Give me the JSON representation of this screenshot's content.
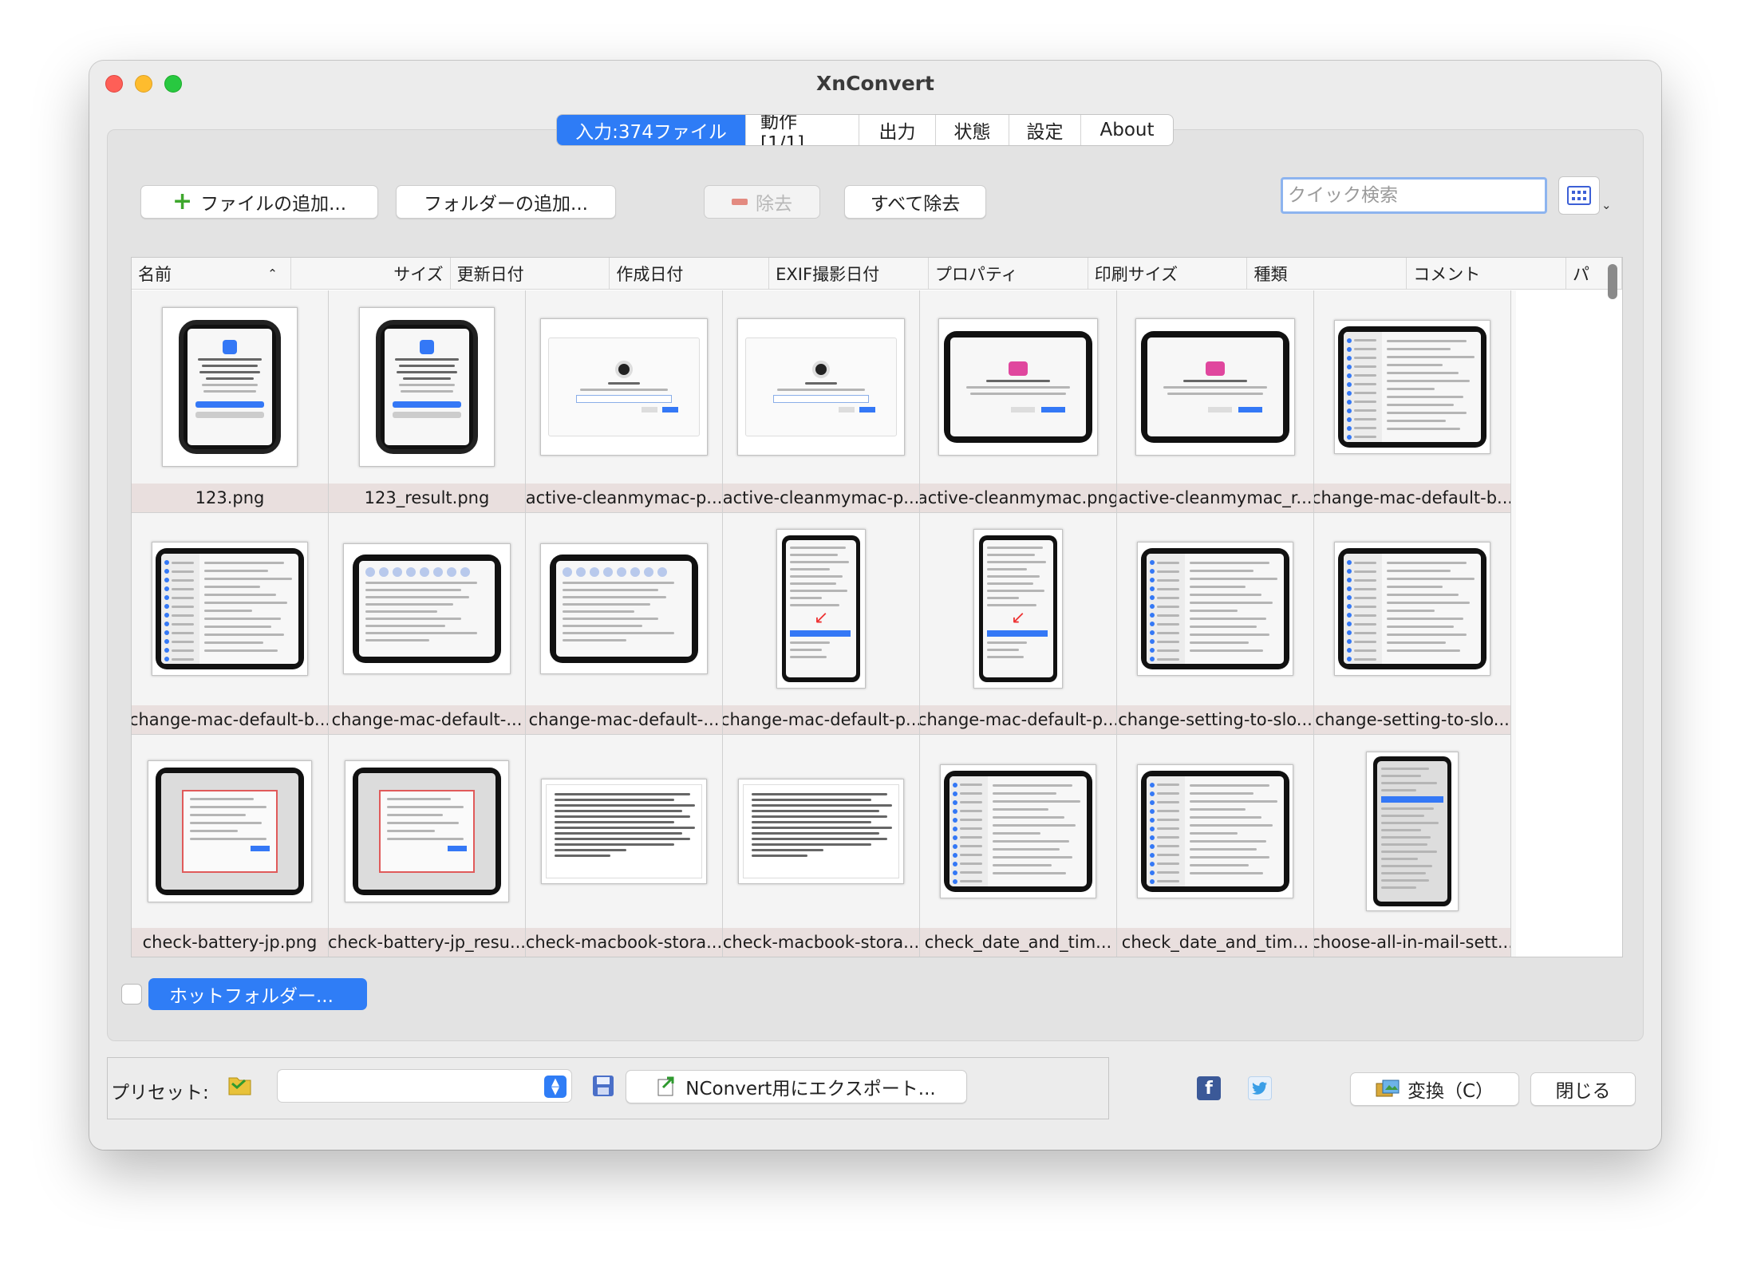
{
  "window": {
    "title": "XnConvert"
  },
  "tabs": [
    {
      "label": "入力:374ファイル",
      "active": true
    },
    {
      "label": "動作 [1/1]",
      "active": false
    },
    {
      "label": "出力",
      "active": false
    },
    {
      "label": "状態",
      "active": false
    },
    {
      "label": "設定",
      "active": false
    },
    {
      "label": "About",
      "active": false
    }
  ],
  "toolbar": {
    "add_files": "ファイルの追加...",
    "add_folder": "フォルダーの追加...",
    "remove": "除去",
    "remove_all": "すべて除去",
    "search_placeholder": "クイック検索"
  },
  "columns": [
    "名前",
    "サイズ",
    "更新日付",
    "作成日付",
    "EXIF撮影日付",
    "プロパティ",
    "印刷サイズ",
    "種類",
    "コメント",
    "パ"
  ],
  "files": [
    {
      "name": "123.png",
      "kind": "device-dialog"
    },
    {
      "name": "123_result.png",
      "kind": "device-dialog"
    },
    {
      "name": "active-cleanmymac-p...",
      "kind": "window-dialog"
    },
    {
      "name": "active-cleanmymac-p...",
      "kind": "window-dialog"
    },
    {
      "name": "active-cleanmymac.png",
      "kind": "device-pink"
    },
    {
      "name": "active-cleanmymac_r...",
      "kind": "device-pink"
    },
    {
      "name": "change-mac-default-b...",
      "kind": "device-settings"
    },
    {
      "name": "change-mac-default-b...",
      "kind": "device-settings"
    },
    {
      "name": "change-mac-default-...",
      "kind": "device-prefs"
    },
    {
      "name": "change-mac-default-...",
      "kind": "device-prefs"
    },
    {
      "name": "change-mac-default-p...",
      "kind": "portrait-menu"
    },
    {
      "name": "change-mac-default-p...",
      "kind": "portrait-menu"
    },
    {
      "name": "change-setting-to-slo...",
      "kind": "device-settings"
    },
    {
      "name": "change-setting-to-slo...",
      "kind": "device-settings"
    },
    {
      "name": "check-battery-jp.png",
      "kind": "device-battery"
    },
    {
      "name": "check-battery-jp_resu...",
      "kind": "device-battery"
    },
    {
      "name": "check-macbook-stora...",
      "kind": "window-text"
    },
    {
      "name": "check-macbook-stora...",
      "kind": "window-text"
    },
    {
      "name": "check_date_and_tim...",
      "kind": "device-settings"
    },
    {
      "name": "check_date_and_tim...",
      "kind": "device-settings"
    },
    {
      "name": "choose-all-in-mail-sett...",
      "kind": "portrait-dark"
    }
  ],
  "hot_folder": {
    "label": "ホットフォルダー...",
    "checked": false
  },
  "preset": {
    "label": "プリセット:",
    "selected": "",
    "export_label": "NConvert用にエクスポート..."
  },
  "footer": {
    "convert_label": "変換（C）",
    "close_label": "閉じる",
    "facebook": "f"
  },
  "colors": {
    "accent": "#2f7df6",
    "caption_bg": "#e9dfde",
    "window_bg": "#ececec"
  }
}
